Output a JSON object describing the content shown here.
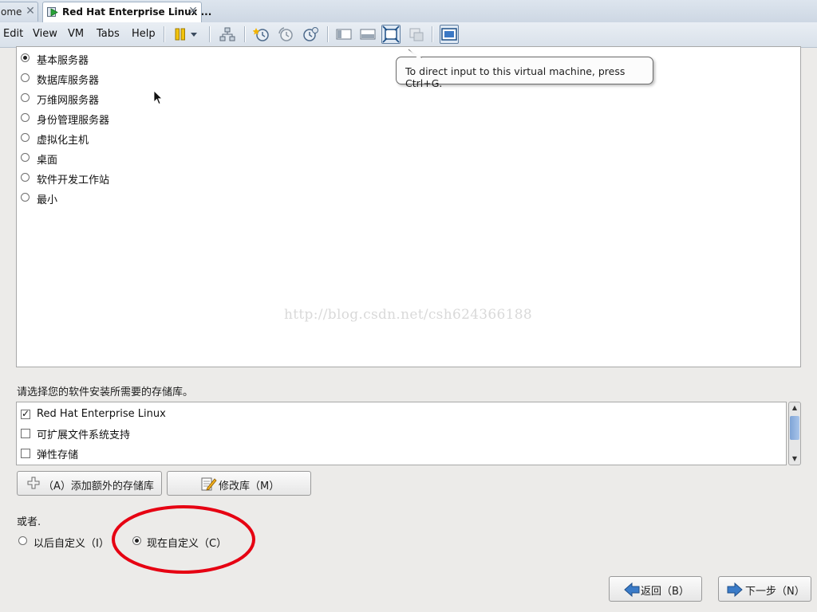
{
  "tabs": [
    {
      "label": "ome"
    },
    {
      "label": "Red Hat Enterprise Linux ..."
    }
  ],
  "menu": [
    "Edit",
    "View",
    "VM",
    "Tabs",
    "Help"
  ],
  "tooltip": "To direct input to this virtual machine, press Ctrl+G.",
  "groups": {
    "selected_index": 0,
    "items": [
      "基本服务器",
      "数据库服务器",
      "万维网服务器",
      "身份管理服务器",
      "虚拟化主机",
      "桌面",
      "软件开发工作站",
      "最小"
    ]
  },
  "watermark": "http://blog.csdn.net/csh624366188",
  "repositories": {
    "prompt": "请选择您的软件安装所需要的存储库。",
    "items": [
      {
        "label": "Red Hat Enterprise Linux",
        "checked": true
      },
      {
        "label": "可扩展文件系统支持",
        "checked": false
      },
      {
        "label": "弹性存储",
        "checked": false
      }
    ]
  },
  "buttons": {
    "add_repo": "（A）添加额外的存储库",
    "modify_repo": "修改库（M）",
    "back": "返回（B）",
    "next": "下一步（N）"
  },
  "customize": {
    "or_label": "或者.",
    "later": "以后自定义（I）",
    "now": "现在自定义（C）",
    "selected": "now"
  },
  "colors": {
    "annotation_circle": "#e60012",
    "tab_strip": "#d6dfe9",
    "window_bg": "#ecebe9"
  },
  "icons": [
    "play-vm-icon",
    "close-icon",
    "pause-icon",
    "dropdown-icon",
    "network-icon",
    "snapshot-take-icon",
    "snapshot-revert-icon",
    "snapshot-manager-icon",
    "console-view-icon",
    "quick-switch-icon",
    "fullscreen-icon",
    "unity-icon",
    "thumbnail-bar-icon",
    "plus-icon",
    "edit-icon",
    "back-arrow-icon",
    "next-arrow-icon",
    "mouse-cursor-icon"
  ]
}
